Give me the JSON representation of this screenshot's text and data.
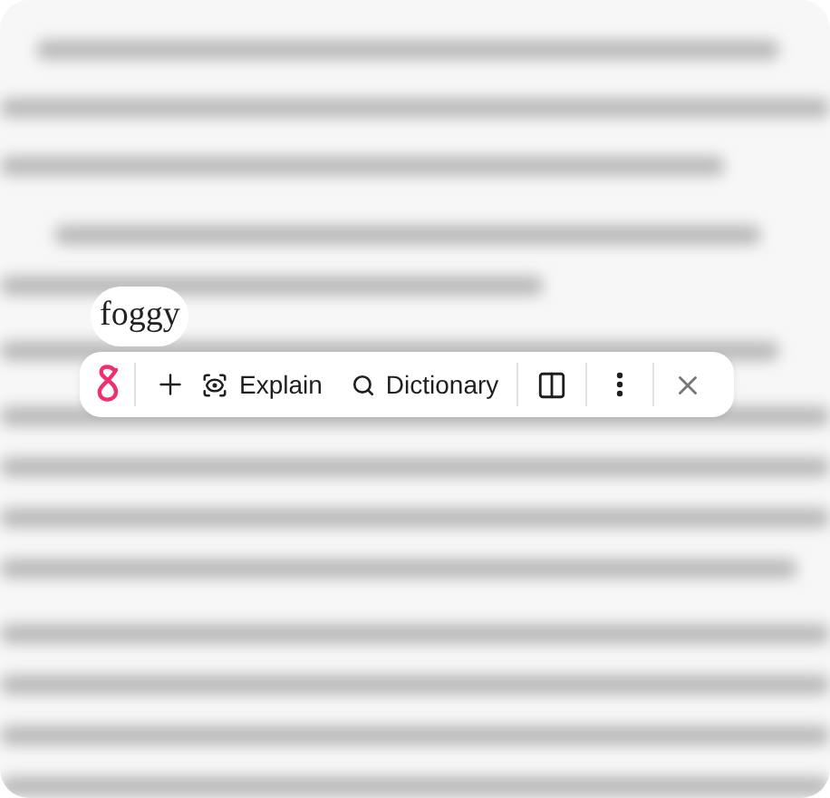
{
  "selection": {
    "word": "foggy"
  },
  "toolbar": {
    "actions": [
      {
        "kind": "add"
      },
      {
        "kind": "explain",
        "label": "Explain"
      },
      {
        "kind": "dictionary",
        "label": "Dictionary"
      },
      {
        "kind": "sidebar"
      },
      {
        "kind": "more"
      },
      {
        "kind": "close"
      }
    ]
  }
}
